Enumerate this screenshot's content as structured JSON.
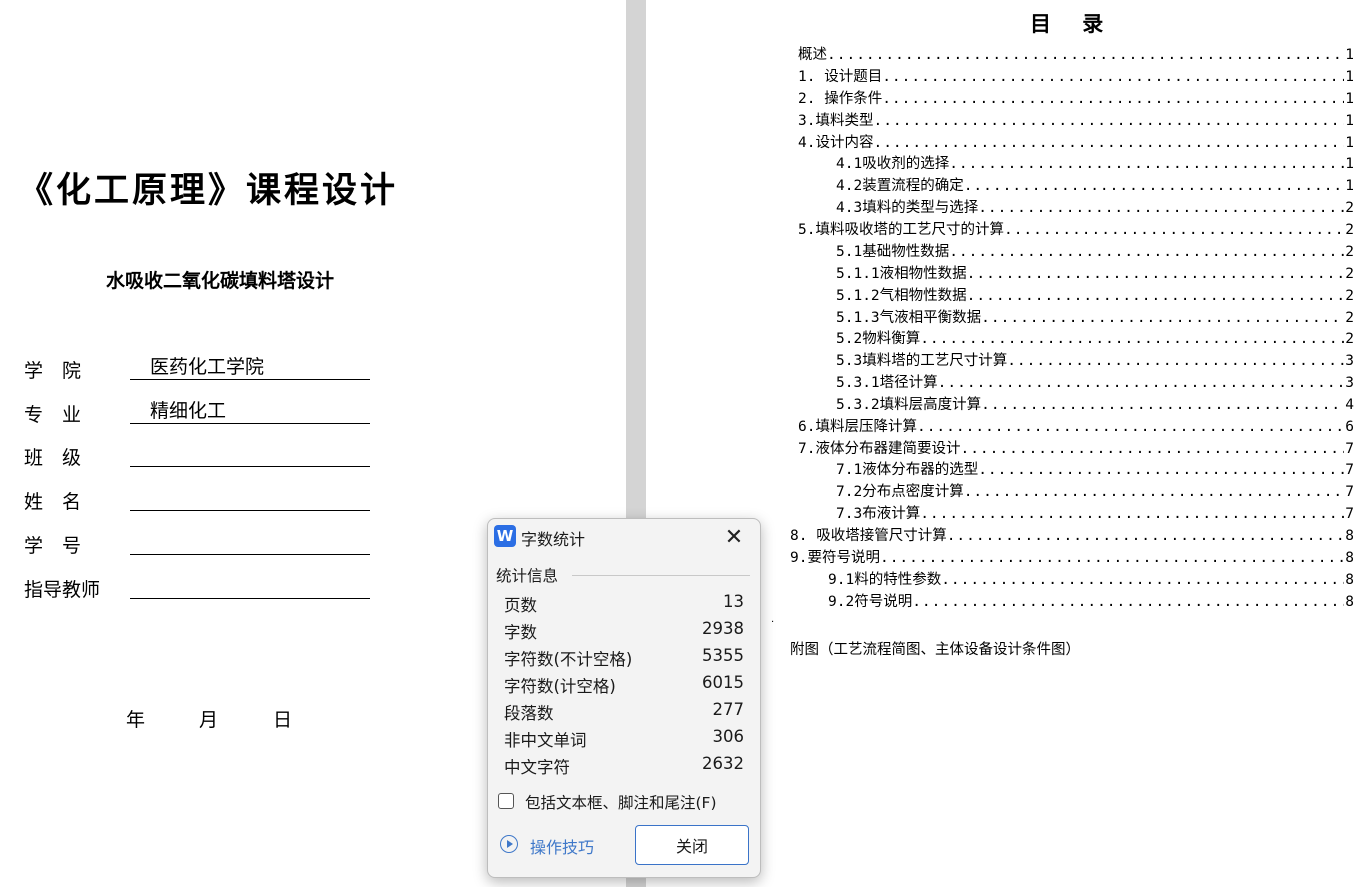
{
  "cover": {
    "title": "《化工原理》课程设计",
    "subtitle": "水吸收二氧化碳填料塔设计",
    "fields": [
      {
        "label": "学　院",
        "value": "医药化工学院"
      },
      {
        "label": "专　业",
        "value": "精细化工"
      },
      {
        "label": "班　级",
        "value": ""
      },
      {
        "label": "姓　名",
        "value": ""
      },
      {
        "label": "学　号",
        "value": ""
      },
      {
        "label": "指导教师",
        "value": ""
      }
    ],
    "date": {
      "year": "年",
      "month": "月",
      "day": "日"
    }
  },
  "toc": {
    "heading": "目 录",
    "entries": [
      {
        "title": "概述",
        "page": "1"
      },
      {
        "title": "1. 设计题目",
        "page": "1"
      },
      {
        "title": "2. 操作条件",
        "page": "1"
      },
      {
        "title": "3.填料类型",
        "page": "1"
      },
      {
        "title": "4.设计内容",
        "page": "1"
      },
      {
        "title": "4.1吸收剂的选择",
        "page": "1"
      },
      {
        "title": "4.2装置流程的确定",
        "page": "1"
      },
      {
        "title": "4.3填料的类型与选择",
        "page": "2"
      },
      {
        "title": "5.填料吸收塔的工艺尺寸的计算",
        "page": "2"
      },
      {
        "title": "5.1基础物性数据",
        "page": "2"
      },
      {
        "title": "5.1.1液相物性数据",
        "page": "2"
      },
      {
        "title": "5.1.2气相物性数据",
        "page": "2"
      },
      {
        "title": "5.1.3气液相平衡数据",
        "page": "2"
      },
      {
        "title": "5.2物料衡算",
        "page": "2"
      },
      {
        "title": "5.3填料塔的工艺尺寸计算",
        "page": "3"
      },
      {
        "title": "5.3.1塔径计算",
        "page": "3"
      },
      {
        "title": "5.3.2填料层高度计算",
        "page": "4"
      },
      {
        "title": "6.填料层压降计算",
        "page": "6"
      },
      {
        "title": "7.液体分布器建简要设计",
        "page": "7"
      },
      {
        "title": "7.1液体分布器的选型",
        "page": "7"
      },
      {
        "title": "7.2分布点密度计算",
        "page": "7"
      },
      {
        "title": "7.3布液计算",
        "page": "7"
      },
      {
        "title": "8. 吸收塔接管尺寸计算",
        "page": "8"
      },
      {
        "title": "9.要符号说明",
        "page": "8"
      },
      {
        "title": "9.1料的特性参数",
        "page": "8"
      },
      {
        "title": "9.2符号说明",
        "page": "8"
      }
    ],
    "appendix": "附图（工艺流程简图、主体设备设计条件图）",
    "stray_mark": "."
  },
  "dialog": {
    "app_icon": "W",
    "title": "字数统计",
    "section": "统计信息",
    "stats": [
      {
        "label": "页数",
        "value": "13"
      },
      {
        "label": "字数",
        "value": "2938"
      },
      {
        "label": "字符数(不计空格)",
        "value": "5355"
      },
      {
        "label": "字符数(计空格)",
        "value": "6015"
      },
      {
        "label": "段落数",
        "value": "277"
      },
      {
        "label": "非中文单词",
        "value": "306"
      },
      {
        "label": "中文字符",
        "value": "2632"
      }
    ],
    "include_checkbox_label": "包括文本框、脚注和尾注(F)",
    "include_checked": false,
    "tips_label": "操作技巧",
    "close_label": "关闭",
    "accent_color": "#3f78c9"
  }
}
